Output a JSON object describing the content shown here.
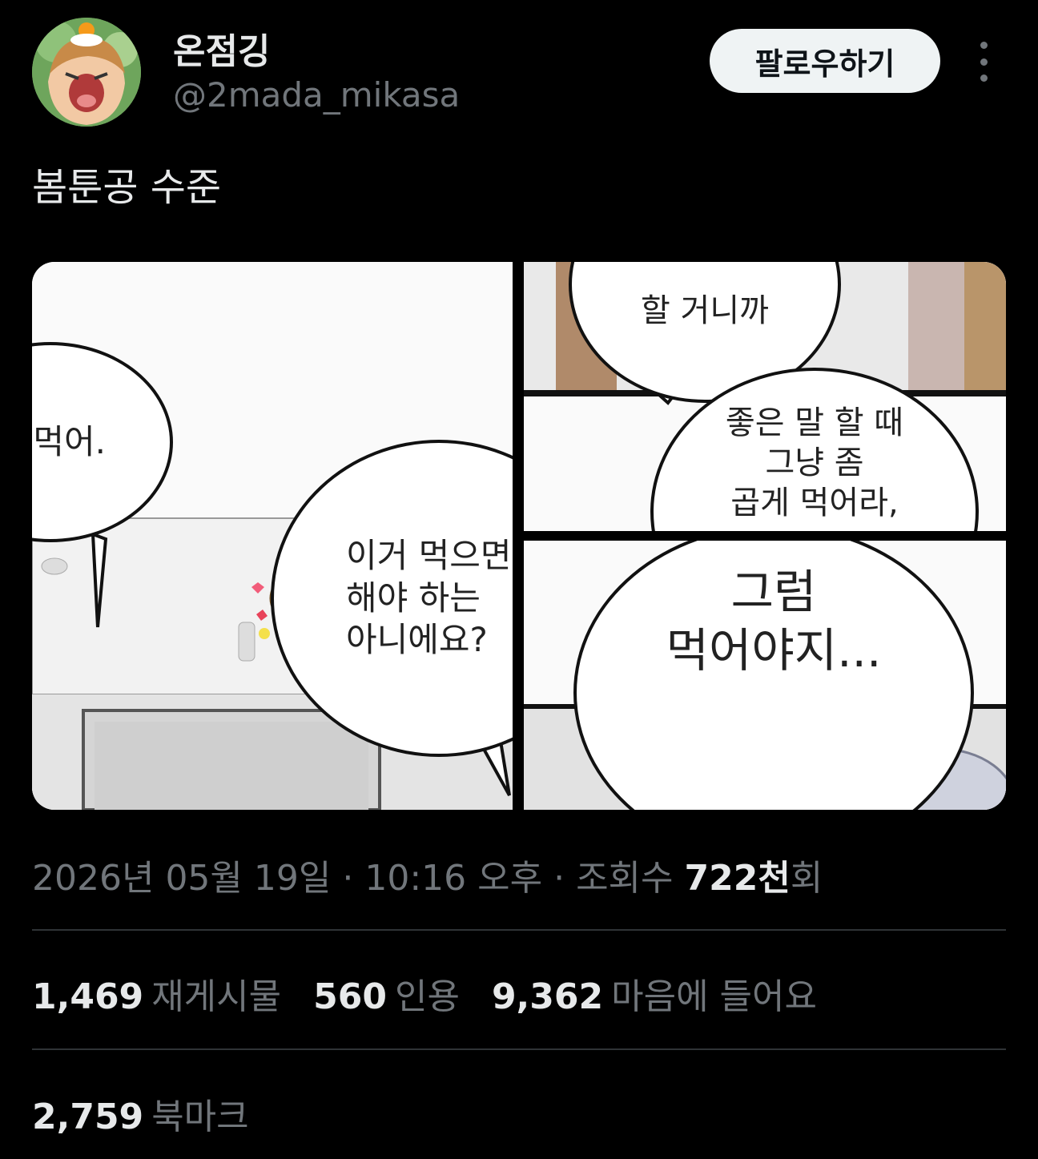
{
  "author": {
    "display_name": "온점깅",
    "handle": "@2mada_mikasa"
  },
  "follow_label": "팔로우하기",
  "more_icon": "more-vertical-icon",
  "tweet": {
    "text": "봄툰공 수준"
  },
  "media": {
    "left_panel": {
      "bubble_1": "먹어.",
      "bubble_2": "이거 먹으면\n해야 하는\n아니에요?"
    },
    "top_right_panel": {
      "bubble_1": "할 거니까",
      "bubble_2": "좋은 말 할 때\n그냥 좀\n곱게 먹어라,"
    },
    "bottom_right_panel": {
      "bubble_1": "그럼\n먹어야지..."
    }
  },
  "meta": {
    "date": "2026년 05월 19일",
    "sep1": " · ",
    "time": "10:16 오후",
    "sep2": " · ",
    "views_label": "조회수 ",
    "views_count": "722천",
    "views_suffix": "회"
  },
  "stats": {
    "reposts_count": "1,469",
    "reposts_label": "재게시물",
    "quotes_count": "560",
    "quotes_label": "인용",
    "likes_count": "9,362",
    "likes_label": "마음에 들어요"
  },
  "bookmarks": {
    "count": "2,759",
    "label": "북마크"
  },
  "colors": {
    "background": "#000000",
    "primary_text": "#e7e9ea",
    "secondary_text": "#71767b",
    "divider": "#2f3336",
    "follow_button_bg": "#eff3f4"
  }
}
